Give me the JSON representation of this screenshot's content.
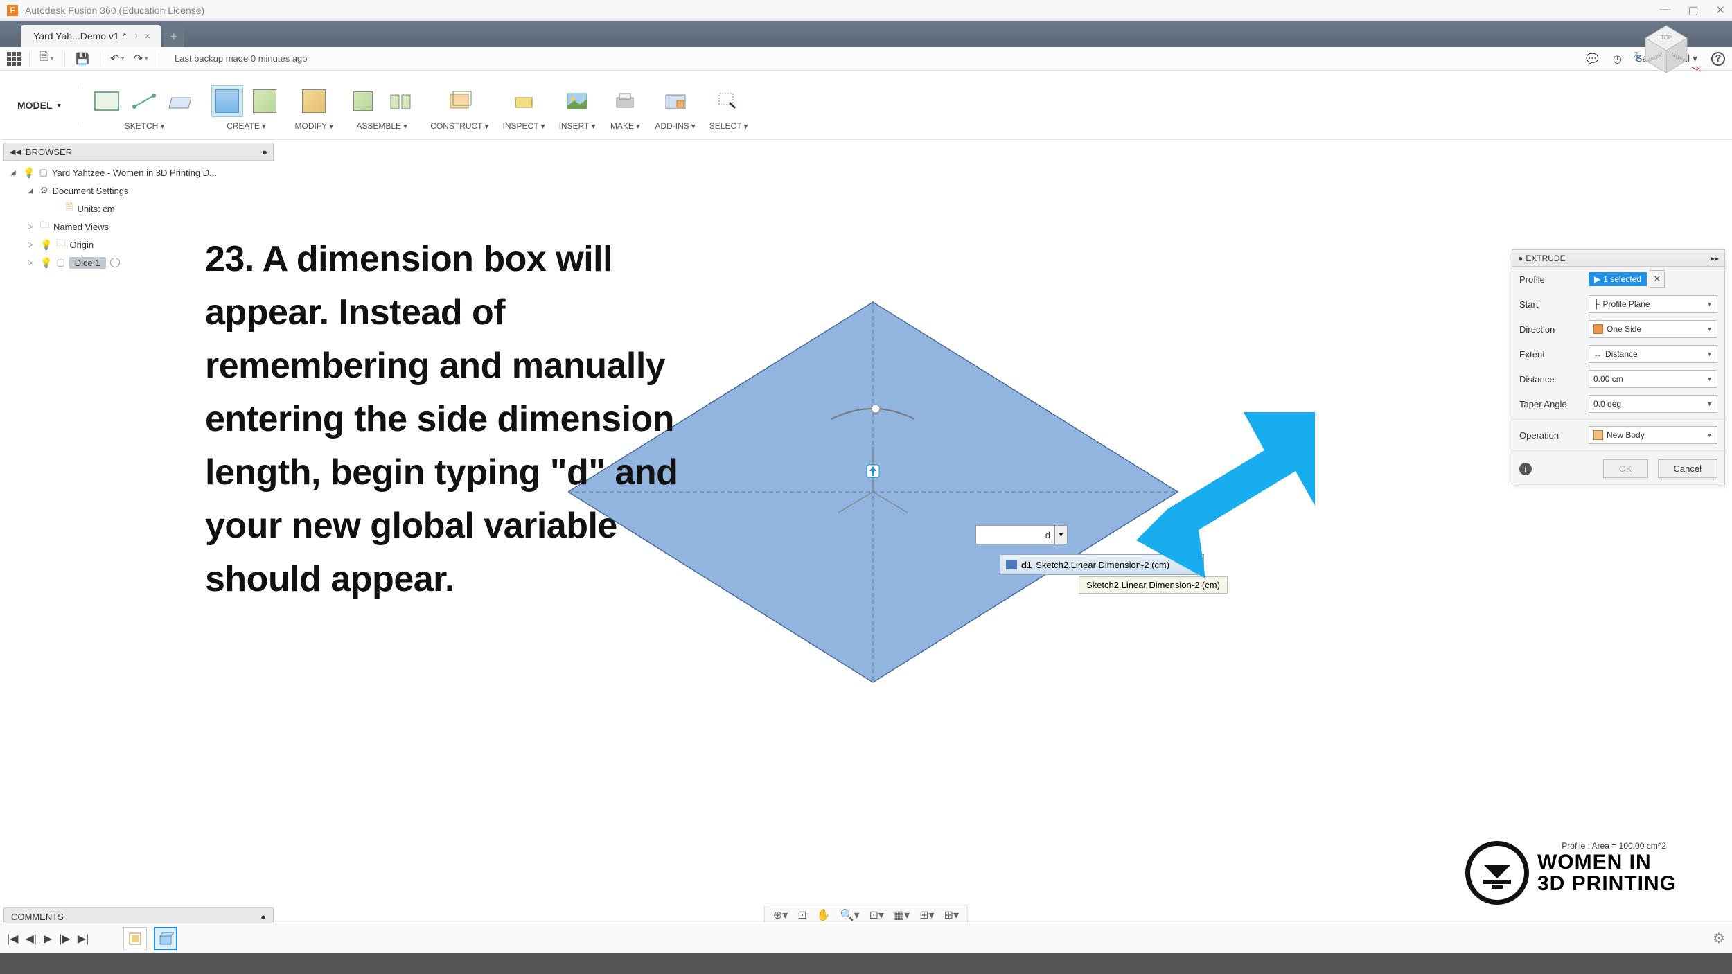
{
  "titlebar": {
    "app_title": "Autodesk Fusion 360 (Education License)",
    "app_icon_letter": "F"
  },
  "tab": {
    "name": "Yard Yah...Demo v1",
    "modified": "*"
  },
  "qat": {
    "backup": "Last backup made 0 minutes ago",
    "user": "Sarah O'Sell"
  },
  "ribbon": {
    "workspace": "MODEL",
    "groups": [
      "SKETCH",
      "CREATE",
      "MODIFY",
      "ASSEMBLE",
      "CONSTRUCT",
      "INSPECT",
      "INSERT",
      "MAKE",
      "ADD-INS",
      "SELECT"
    ]
  },
  "browser": {
    "title": "BROWSER",
    "root": "Yard Yahtzee - Women in 3D Printing D...",
    "doc_settings": "Document Settings",
    "units": "Units: cm",
    "named_views": "Named Views",
    "origin": "Origin",
    "dice": "Dice:1"
  },
  "instruction": "23. A dimension box will appear. Instead of remembering and manually entering the side dimension length, begin typing \"d\" and your new global variable should appear.",
  "dim_input": {
    "value": "d"
  },
  "autocomplete": {
    "line1_prefix": "d1",
    "line1": "Sketch2.Linear Dimension-2 (cm)",
    "line2": "Sketch2.Linear Dimension-2 (cm)"
  },
  "extrude": {
    "title": "EXTRUDE",
    "profile_lbl": "Profile",
    "profile_val": "1 selected",
    "start_lbl": "Start",
    "start_val": "Profile Plane",
    "direction_lbl": "Direction",
    "direction_val": "One Side",
    "extent_lbl": "Extent",
    "extent_val": "Distance",
    "distance_lbl": "Distance",
    "distance_val": "0.00 cm",
    "taper_lbl": "Taper Angle",
    "taper_val": "0.0 deg",
    "operation_lbl": "Operation",
    "operation_val": "New Body",
    "ok": "OK",
    "cancel": "Cancel"
  },
  "comments": "COMMENTS",
  "logo": {
    "line1": "WOMEN IN",
    "line2": "3D PRINTING"
  },
  "profile_area": "Profile : Area = 100.00 cm^2"
}
